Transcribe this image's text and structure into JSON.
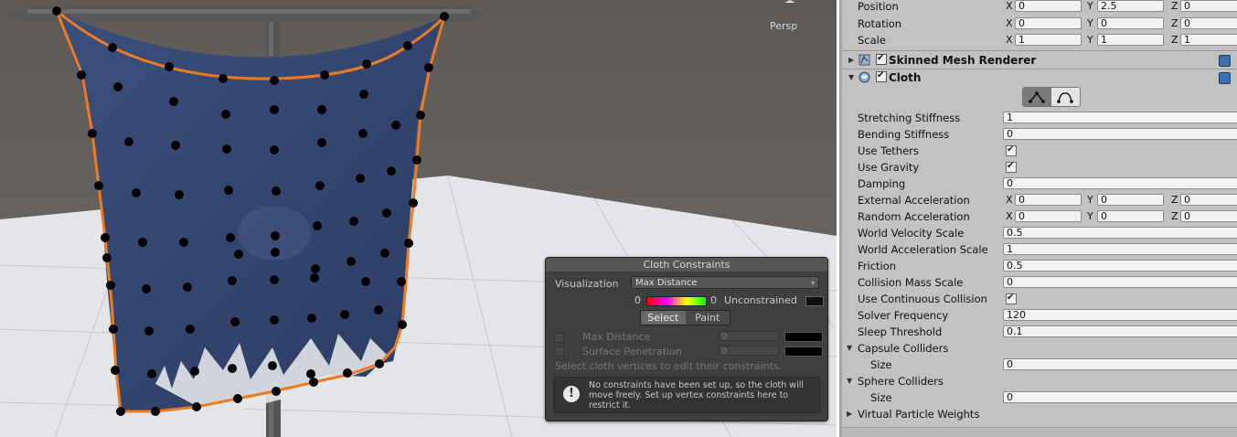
{
  "scene": {
    "view_label": "Persp"
  },
  "cloth_constraints": {
    "title": "Cloth Constraints",
    "visualization_label": "Visualization",
    "visualization_value": "Max Distance",
    "gradient_min": "0",
    "gradient_max": "0",
    "unconstrained_label": "Unconstrained",
    "select_label": "Select",
    "paint_label": "Paint",
    "max_distance_label": "Max Distance",
    "max_distance_value": "0",
    "surface_penetration_label": "Surface Penetration",
    "surface_penetration_value": "0",
    "hint": "Select cloth vertices to edit their constraints.",
    "info_message": "No constraints have been set up, so the cloth will move freely. Set up vertex constraints here to restrict it."
  },
  "inspector": {
    "transform": {
      "position": {
        "label": "Position",
        "x": "0",
        "y": "2.5",
        "z": "0"
      },
      "rotation": {
        "label": "Rotation",
        "x": "0",
        "y": "0",
        "z": "0"
      },
      "scale": {
        "label": "Scale",
        "x": "1",
        "y": "1",
        "z": "1"
      },
      "axis_x": "X",
      "axis_y": "Y",
      "axis_z": "Z"
    },
    "skinned_mesh_renderer": {
      "name": "Skinned Mesh Renderer"
    },
    "cloth": {
      "name": "Cloth",
      "stretching_stiffness": {
        "label": "Stretching Stiffness",
        "value": "1"
      },
      "bending_stiffness": {
        "label": "Bending Stiffness",
        "value": "0"
      },
      "use_tethers": {
        "label": "Use Tethers"
      },
      "use_gravity": {
        "label": "Use Gravity"
      },
      "damping": {
        "label": "Damping",
        "value": "0"
      },
      "external_acceleration": {
        "label": "External Acceleration",
        "x": "0",
        "y": "0",
        "z": "0"
      },
      "random_acceleration": {
        "label": "Random Acceleration",
        "x": "0",
        "y": "0",
        "z": "0"
      },
      "world_velocity_scale": {
        "label": "World Velocity Scale",
        "value": "0.5"
      },
      "world_acceleration_scale": {
        "label": "World Acceleration Scale",
        "value": "1"
      },
      "friction": {
        "label": "Friction",
        "value": "0.5"
      },
      "collision_mass_scale": {
        "label": "Collision Mass Scale",
        "value": "0"
      },
      "use_continuous_collision": {
        "label": "Use Continuous Collision"
      },
      "solver_frequency": {
        "label": "Solver Frequency",
        "value": "120"
      },
      "sleep_threshold": {
        "label": "Sleep Threshold",
        "value": "0.1"
      },
      "capsule_colliders": {
        "label": "Capsule Colliders",
        "size_label": "Size",
        "size": "0"
      },
      "sphere_colliders": {
        "label": "Sphere Colliders",
        "size_label": "Size",
        "size": "0"
      },
      "virtual_particle_weights": {
        "label": "Virtual Particle Weights"
      }
    }
  }
}
